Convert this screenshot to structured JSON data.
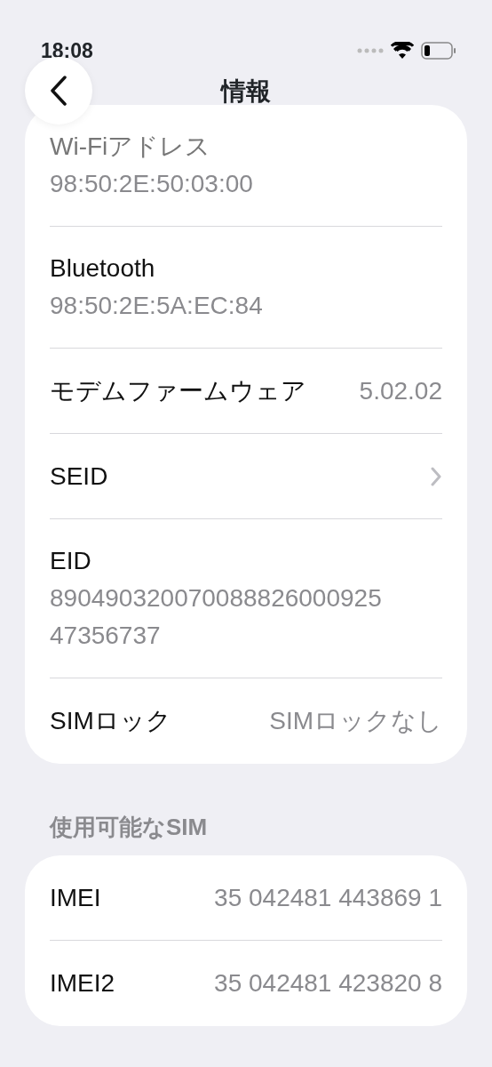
{
  "status_bar": {
    "time": "18:08"
  },
  "nav": {
    "title": "情報"
  },
  "info_rows": [
    {
      "kind": "stacked",
      "label": "Wi-Fiアドレス",
      "value": "98:50:2E:50:03:00",
      "faded": true
    },
    {
      "kind": "stacked",
      "label": "Bluetooth",
      "value": "98:50:2E:5A:EC:84",
      "faded": false
    },
    {
      "kind": "inline",
      "label": "モデムファームウェア",
      "value": "5.02.02",
      "faded": false
    },
    {
      "kind": "link",
      "label": "SEID",
      "faded": false
    },
    {
      "kind": "stacked",
      "label": "EID",
      "value": "89049032007008882600092547356737",
      "faded": false
    },
    {
      "kind": "inline",
      "label": "SIMロック",
      "value": "SIMロックなし",
      "faded": false
    }
  ],
  "sim_section": {
    "header": "使用可能なSIM",
    "rows": [
      {
        "kind": "inline",
        "label": "IMEI",
        "value": "35 042481 443869 1"
      },
      {
        "kind": "inline",
        "label": "IMEI2",
        "value": "35 042481 423820 8"
      }
    ]
  }
}
